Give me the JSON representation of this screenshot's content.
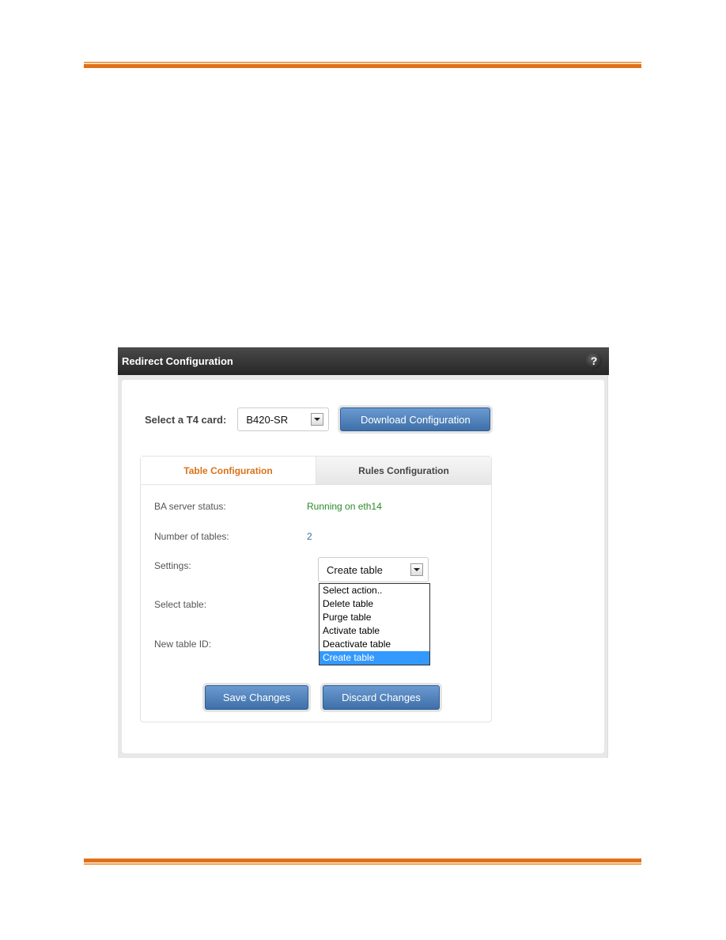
{
  "window": {
    "title": "Redirect Configuration",
    "help_icon": "question-mark-icon"
  },
  "card_select": {
    "label": "Select a T4 card:",
    "value": "B420-SR"
  },
  "download_button": "Download Configuration",
  "tabs": [
    {
      "label": "Table Configuration",
      "active": true
    },
    {
      "label": "Rules Configuration",
      "active": false
    }
  ],
  "fields": {
    "ba_status_label": "BA server status:",
    "ba_status_value": "Running on eth14",
    "num_tables_label": "Number of tables:",
    "num_tables_value": "2",
    "settings_label": "Settings:",
    "settings_value": "Create table",
    "select_table_label": "Select table:",
    "new_table_id_label": "New table ID:"
  },
  "settings_options": [
    "Select action..",
    "Delete table",
    "Purge table",
    "Activate table",
    "Deactivate table",
    "Create table"
  ],
  "settings_selected_index": 5,
  "buttons": {
    "save": "Save Changes",
    "discard": "Discard Changes"
  },
  "colors": {
    "accent_orange": "#e07018",
    "active_tab": "#d9731a",
    "status_green": "#2a8a2a",
    "button_blue": "#4a7cb8",
    "highlight_blue": "#3399ff"
  }
}
